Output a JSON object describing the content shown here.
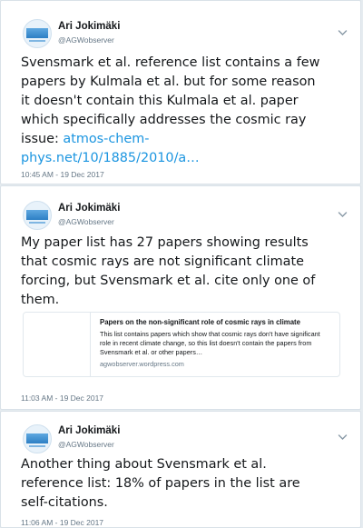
{
  "tweets": [
    {
      "author_name": "Ari Jokimäki",
      "author_handle": "@AGWobserver",
      "text_lines": [
        "Svensmark et al. reference list contains a few",
        "papers by Kulmala et al. but for some reason",
        "it doesn't contain this Kulmala et al. paper",
        "which specifically addresses the cosmic ray"
      ],
      "text_issue": "issue: ",
      "link_part1": "atmos-chem-",
      "link_part2": "phys.net/10/1885/2010/a…",
      "timestamp": "10:45 AM - 19 Dec 2017",
      "menu_icon": "chevron-down-icon"
    },
    {
      "author_name": "Ari Jokimäki",
      "author_handle": "@AGWobserver",
      "text_lines": [
        "My paper list has 27 papers showing results",
        "that cosmic rays are not significant climate",
        "forcing, but Svensmark et al. cite only one of",
        "them."
      ],
      "card": {
        "title": "Papers on the non-significant role of cosmic rays in climate",
        "description": "This list contains papers which show that cosmic rays don't have significant role in recent climate change, so this list doesn't contain the papers from Svensmark et al. or other papers…",
        "domain": "agwobserver.wordpress.com"
      },
      "timestamp": "11:03 AM - 19 Dec 2017",
      "menu_icon": "chevron-down-icon"
    },
    {
      "author_name": "Ari Jokimäki",
      "author_handle": "@AGWobserver",
      "text_lines": [
        "Another thing about Svensmark et al.",
        "reference list: 18% of papers in the list are",
        "self-citations."
      ],
      "timestamp": "11:06 AM - 19 Dec 2017",
      "menu_icon": "chevron-down-icon"
    }
  ],
  "colors": {
    "background": "#e6ecf0",
    "link": "#1b95e0",
    "secondary_text": "#657786",
    "primary_text": "#14171a"
  }
}
